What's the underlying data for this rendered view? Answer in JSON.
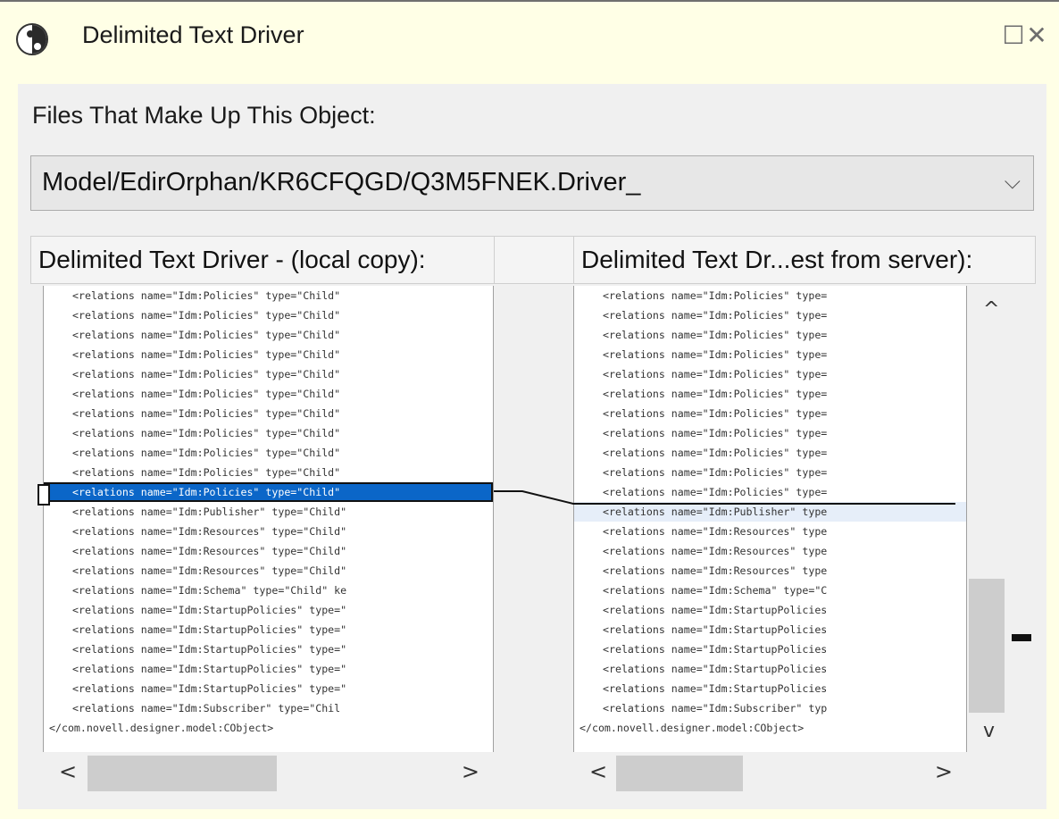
{
  "window": {
    "title": "Delimited Text Driver",
    "maximize_glyph": "☐",
    "close_glyph": "✕"
  },
  "files_label": "Files That Make Up This Object:",
  "file_select": {
    "value": "Model/EdirOrphan/KR6CFQGD/Q3M5FNEK.Driver_",
    "arrow": "⌵"
  },
  "left_header": "Delimited Text Driver - (local copy):",
  "right_header": "Delimited Text Dr...est from server):",
  "left_lines": [
    "<relations name=\"Idm:Policies\" type=\"Child\"",
    "<relations name=\"Idm:Policies\" type=\"Child\"",
    "<relations name=\"Idm:Policies\" type=\"Child\"",
    "<relations name=\"Idm:Policies\" type=\"Child\"",
    "<relations name=\"Idm:Policies\" type=\"Child\"",
    "<relations name=\"Idm:Policies\" type=\"Child\"",
    "<relations name=\"Idm:Policies\" type=\"Child\"",
    "<relations name=\"Idm:Policies\" type=\"Child\"",
    "<relations name=\"Idm:Policies\" type=\"Child\"",
    "<relations name=\"Idm:Policies\" type=\"Child\"",
    "<relations name=\"Idm:Policies\" type=\"Child\"",
    "<relations name=\"Idm:Publisher\" type=\"Child\"",
    "<relations name=\"Idm:Resources\" type=\"Child\"",
    "<relations name=\"Idm:Resources\" type=\"Child\"",
    "<relations name=\"Idm:Resources\" type=\"Child\"",
    "<relations name=\"Idm:Schema\" type=\"Child\" ke",
    "<relations name=\"Idm:StartupPolicies\" type=\"",
    "<relations name=\"Idm:StartupPolicies\" type=\"",
    "<relations name=\"Idm:StartupPolicies\" type=\"",
    "<relations name=\"Idm:StartupPolicies\" type=\"",
    "<relations name=\"Idm:StartupPolicies\" type=\"",
    "<relations name=\"Idm:Subscriber\" type=\"Chil",
    "</com.novell.designer.model:CObject>"
  ],
  "right_lines": [
    "<relations name=\"Idm:Policies\" type=",
    "<relations name=\"Idm:Policies\" type=",
    "<relations name=\"Idm:Policies\" type=",
    "<relations name=\"Idm:Policies\" type=",
    "<relations name=\"Idm:Policies\" type=",
    "<relations name=\"Idm:Policies\" type=",
    "<relations name=\"Idm:Policies\" type=",
    "<relations name=\"Idm:Policies\" type=",
    "<relations name=\"Idm:Policies\" type=",
    "<relations name=\"Idm:Policies\" type=",
    "<relations name=\"Idm:Policies\" type=",
    "<relations name=\"Idm:Publisher\" type",
    "<relations name=\"Idm:Resources\" type",
    "<relations name=\"Idm:Resources\" type",
    "<relations name=\"Idm:Resources\" type",
    "<relations name=\"Idm:Schema\" type=\"C",
    "<relations name=\"Idm:StartupPolicies",
    "<relations name=\"Idm:StartupPolicies",
    "<relations name=\"Idm:StartupPolicies",
    "<relations name=\"Idm:StartupPolicies",
    "<relations name=\"Idm:StartupPolicies",
    "<relations name=\"Idm:Subscriber\" typ",
    "</com.novell.designer.model:CObject>"
  ],
  "scroll": {
    "up": "^",
    "down": "v",
    "left": "<",
    "right": ">"
  },
  "colors": {
    "selection": "#0b66c8",
    "frame_bg": "#ffffe6",
    "panel_bg": "#f0f0f0"
  }
}
